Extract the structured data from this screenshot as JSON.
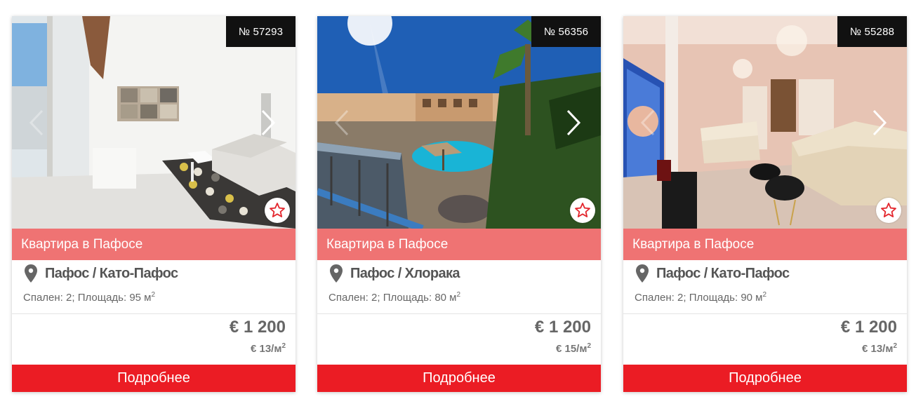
{
  "colors": {
    "title_bar": "#ef7373",
    "button": "#eb1c24",
    "badge": "#111111",
    "star": "#e3262d"
  },
  "listings": [
    {
      "number": "№ 57293",
      "title": "Квартира в Пафосе",
      "location": "Пафос / Като-Пафос",
      "details": "Спален: 2; Площадь: 95 м",
      "details_sup": "2",
      "price": "€ 1 200",
      "price_per_m": "€ 13/м",
      "price_per_m_sup": "2",
      "button": "Подробнее"
    },
    {
      "number": "№ 56356",
      "title": "Квартира в Пафосе",
      "location": "Пафос / Хлоракa",
      "details": "Спален: 2; Площадь: 80 м",
      "details_sup": "2",
      "price": "€ 1 200",
      "price_per_m": "€ 15/м",
      "price_per_m_sup": "2",
      "button": "Подробнее"
    },
    {
      "number": "№ 55288",
      "title": "Квартира в Пафосе",
      "location": "Пафос / Като-Пафос",
      "details": "Спален: 2; Площадь: 90 м",
      "details_sup": "2",
      "price": "€ 1 200",
      "price_per_m": "€ 13/м",
      "price_per_m_sup": "2",
      "button": "Подробнее"
    }
  ]
}
